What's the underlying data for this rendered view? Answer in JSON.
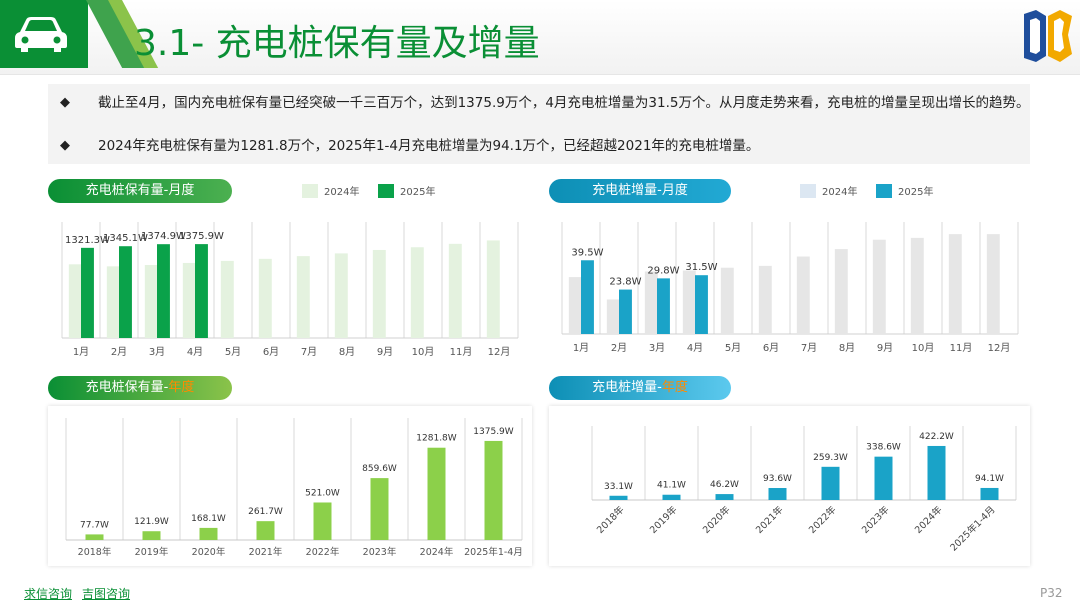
{
  "header": {
    "title": "3.1- 充电桩保有量及增量"
  },
  "bullets": [
    "截止至4月，国内充电桩保有量已经突破一千三百万个，达到1375.9万个，4月充电桩增量为31.5万个。从月度走势来看，充电桩的增量呈现出增长的趋势。",
    "2024年充电桩保有量为1281.8万个，2025年1-4月充电桩增量为94.1万个，已经超越2021年的充电桩增量。"
  ],
  "bullet_mark": "◆",
  "panels": {
    "stock_monthly": {
      "label": "充电桩保有量-月度"
    },
    "incr_monthly": {
      "label": "充电桩增量-月度"
    },
    "stock_yearly": {
      "label_main": "充电桩保有量-",
      "label_hl": "年度"
    },
    "incr_yearly": {
      "label_main": "充电桩增量-",
      "label_hl": "年度"
    }
  },
  "legends": {
    "stock": {
      "s2024": "2024年",
      "s2025": "2025年"
    },
    "incr": {
      "s2024": "2024年",
      "s2025": "2025年"
    }
  },
  "colors": {
    "green_dark": "#0aa24a",
    "green_light": "#e4f2df",
    "green_year": "#8cd04a",
    "blue_dark": "#1aa3c8",
    "grey_light": "#e6e6e6",
    "blue_light": "#dce7f2"
  },
  "footer": {
    "link1": "求信咨询",
    "link2": "吉图咨询",
    "page": "P32"
  },
  "chart_data": [
    {
      "type": "bar",
      "categories": [
        "1月",
        "2月",
        "3月",
        "4月",
        "5月",
        "6月",
        "7月",
        "8月",
        "9月",
        "10月",
        "11月",
        "12月"
      ],
      "series": [
        {
          "name": "2024年",
          "values": [
            1080,
            1050,
            1070,
            1100,
            1130,
            1160,
            1200,
            1240,
            1290,
            1330,
            1380,
            1430
          ]
        },
        {
          "name": "2025年",
          "values": [
            1321.3,
            1345.1,
            1374.9,
            1375.9
          ]
        }
      ],
      "data_labels": [
        "1321.3W",
        "1345.1W",
        "1374.9W",
        "1375.9W"
      ],
      "ylim": [
        0,
        1700
      ]
    },
    {
      "type": "bar",
      "categories": [
        "1月",
        "2月",
        "3月",
        "4月",
        "5月",
        "6月",
        "7月",
        "8月",
        "9月",
        "10月",
        "11月",
        "12月"
      ],
      "series": [
        {
          "name": "2024年",
          "values": [
            30.5,
            18.5,
            33.5,
            34.0,
            35.5,
            36.5,
            41.5,
            45.5,
            50.5,
            51.5,
            53.5,
            53.5
          ]
        },
        {
          "name": "2025年",
          "values": [
            39.5,
            23.8,
            29.8,
            31.5
          ]
        }
      ],
      "data_labels": [
        "39.5W",
        "23.8W",
        "29.8W",
        "31.5W"
      ],
      "ylim": [
        0,
        60
      ]
    },
    {
      "type": "bar",
      "categories": [
        "2018年",
        "2019年",
        "2020年",
        "2021年",
        "2022年",
        "2023年",
        "2024年",
        "2025年1-4月"
      ],
      "values": [
        77.7,
        121.9,
        168.1,
        261.7,
        521.0,
        859.6,
        1281.8,
        1375.9
      ],
      "data_labels": [
        "77.7W",
        "121.9W",
        "168.1W",
        "261.7W",
        "521.0W",
        "859.6W",
        "1281.8W",
        "1375.9W"
      ],
      "ylim": [
        0,
        1500
      ]
    },
    {
      "type": "bar",
      "categories": [
        "2018年",
        "2019年",
        "2020年",
        "2021年",
        "2022年",
        "2023年",
        "2024年",
        "2025年1-4月"
      ],
      "values": [
        33.1,
        41.1,
        46.2,
        93.6,
        259.3,
        338.6,
        422.2,
        94.1
      ],
      "data_labels": [
        "33.1W",
        "41.1W",
        "46.2W",
        "93.6W",
        "259.3W",
        "338.6W",
        "422.2W",
        "94.1W"
      ],
      "ylim": [
        0,
        500
      ]
    }
  ]
}
